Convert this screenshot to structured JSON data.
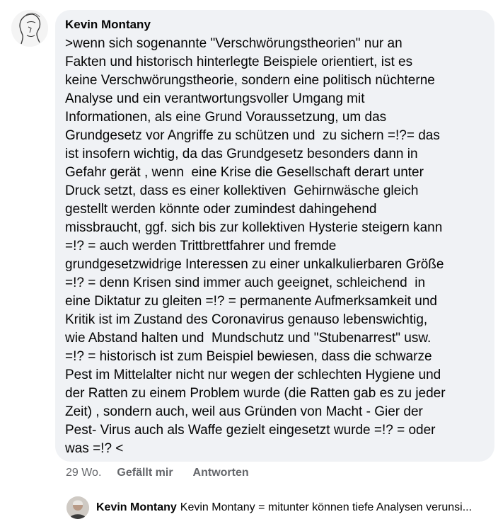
{
  "comment": {
    "author": "Kevin Montany",
    "avatar_icon": "sketch-face-avatar",
    "lines": [
      ">wenn sich sogenannte \"Verschwörungstheorien\" nur an",
      "Fakten und historisch hinterlegte Beispiele orientiert, ist es",
      "keine Verschwörungstheorie, sondern eine politisch nüchterne",
      "Analyse und ein verantwortungsvoller Umgang mit",
      "Informationen, als eine Grund Voraussetzung, um das",
      "Grundgesetz vor Angriffe zu schützen und  zu sichern =!?= das",
      "ist insofern wichtig, da das Grundgesetz besonders dann in",
      "Gefahr gerät , wenn  eine Krise die Gesellschaft derart unter",
      "Druck setzt, dass es einer kollektiven  Gehirnwäsche gleich",
      "gestellt werden könnte oder zumindest dahingehend",
      "missbraucht, ggf. sich bis zur kollektiven Hysterie steigern kann",
      "=!? = auch werden Trittbrettfahrer und fremde",
      "grundgesetzwidrige Interessen zu einer unkalkulierbaren Größe",
      "=!? = denn Krisen sind immer auch geeignet, schleichend  in",
      "eine Diktatur zu gleiten =!? = permanente Aufmerksamkeit und",
      "Kritik ist im Zustand des Coronavirus genauso lebenswichtig,",
      "wie Abstand halten und  Mundschutz und \"Stubenarrest\" usw.",
      "=!? = historisch ist zum Beispiel bewiesen, dass die schwarze",
      "Pest im Mittelalter nicht nur wegen der schlechten Hygiene und",
      "der Ratten zu einem Problem wurde (die Ratten gab es zu jeder",
      "Zeit) , sondern auch, weil aus Gründen von Macht - Gier der",
      "Pest- Virus auch als Waffe gezielt eingesetzt wurde =!? = oder",
      "was =!? <"
    ]
  },
  "actions": {
    "time": "29 Wo.",
    "like": "Gefällt mir",
    "reply": "Antworten"
  },
  "reply_preview": {
    "author": "Kevin Montany",
    "text": "Kevin Montany = mitunter können tiefe Analysen verunsi...",
    "avatar_icon": "photo-avatar"
  },
  "colors": {
    "bubble_bg": "#f0f2f5",
    "meta_text": "#65676b",
    "text": "#050505"
  }
}
